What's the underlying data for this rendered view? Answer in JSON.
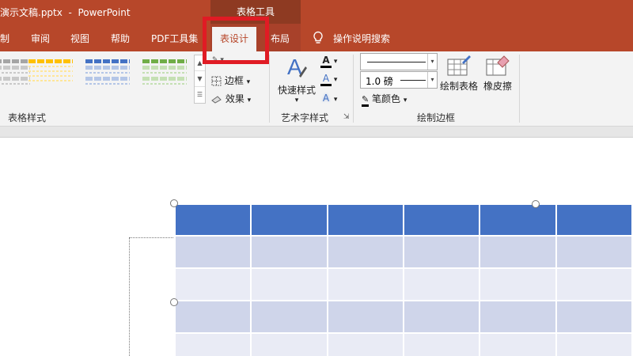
{
  "title_bar": {
    "text": "演示文稿.pptx  -  PowerPoint",
    "context_label": "表格工具",
    "background": "#b7472a"
  },
  "tabs": [
    {
      "label": "制"
    },
    {
      "label": "审阅"
    },
    {
      "label": "视图"
    },
    {
      "label": "帮助"
    },
    {
      "label": "PDF工具集"
    },
    {
      "label": "表设计",
      "active": true
    },
    {
      "label": "布局"
    },
    {
      "label": "操作说明搜索"
    }
  ],
  "ribbon": {
    "table_styles": {
      "group_label": "表格样式",
      "thumb_colors": [
        "#a5a5a5",
        "#ffc000",
        "#4472c4",
        "#70ad47"
      ]
    },
    "shading_buttons": [
      {
        "label": "边框"
      },
      {
        "label": "效果"
      }
    ],
    "wordart": {
      "quick_styles_label": "快速样式",
      "group_label": "艺术字样式"
    },
    "draw_borders": {
      "pen_weight": "1.0 磅",
      "pen_color_label": "笔颜色",
      "draw_table_label": "绘制表格",
      "eraser_label": "橡皮擦",
      "group_label": "绘制边框"
    }
  },
  "slide_table": {
    "header_color": "#4472c4",
    "band1_color": "#cfd5ea",
    "band2_color": "#e9ebf5",
    "columns": 6,
    "rows": 5
  }
}
